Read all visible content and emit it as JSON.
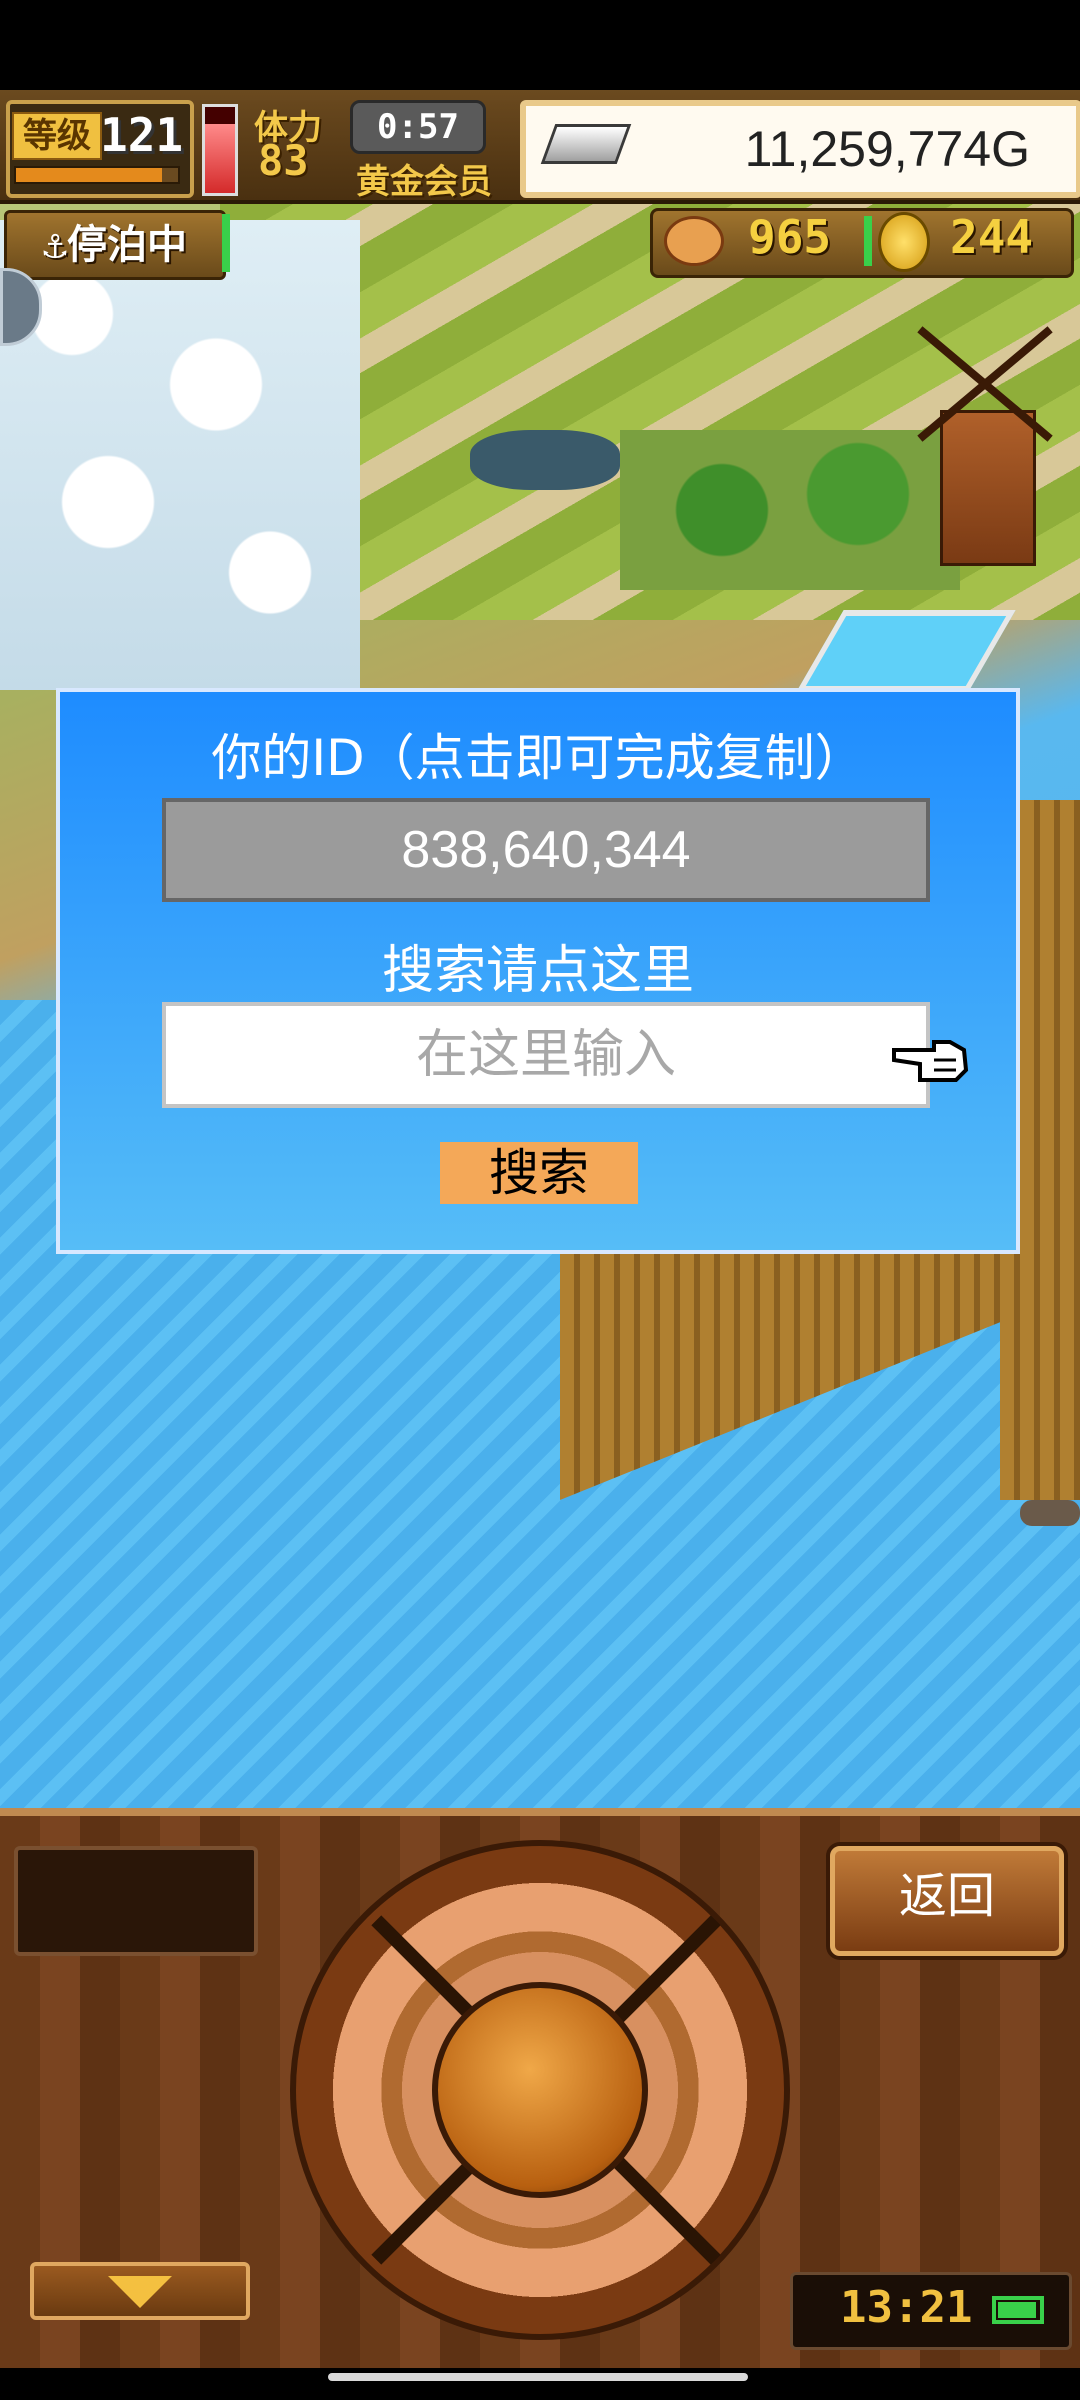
{
  "hud": {
    "level_label": "等级",
    "level_value": "121",
    "level_progress_percent": 90,
    "stamina_label": "体力",
    "stamina_value": "83",
    "stamina_fill_percent": 80,
    "timer": "0:57",
    "member_label": "黄金会员",
    "gold": "11,259,774G",
    "docked_label": "⚓停泊中",
    "food": "965",
    "coins": "244"
  },
  "dialog": {
    "title": "你的ID（点击即可完成复制）",
    "id_value": "838,640,344",
    "search_hint": "搜索请点这里",
    "search_placeholder": "在这里输入",
    "search_value": "",
    "search_button": "搜索"
  },
  "controls": {
    "back_button": "返回",
    "clock": "13:21"
  },
  "colors": {
    "dialog_top": "#1e8cff",
    "dialog_bottom": "#56bdf7",
    "id_box": "#9b9b9b",
    "search_button": "#f4a858",
    "gold_text": "#f5d040",
    "battery": "#39d04a"
  },
  "icons": {
    "silver": "silver-ingot-icon",
    "food": "meat-icon",
    "coin": "gold-coin-icon",
    "hand": "pointing-hand-icon",
    "down": "down-arrow-icon",
    "battery": "battery-icon"
  }
}
